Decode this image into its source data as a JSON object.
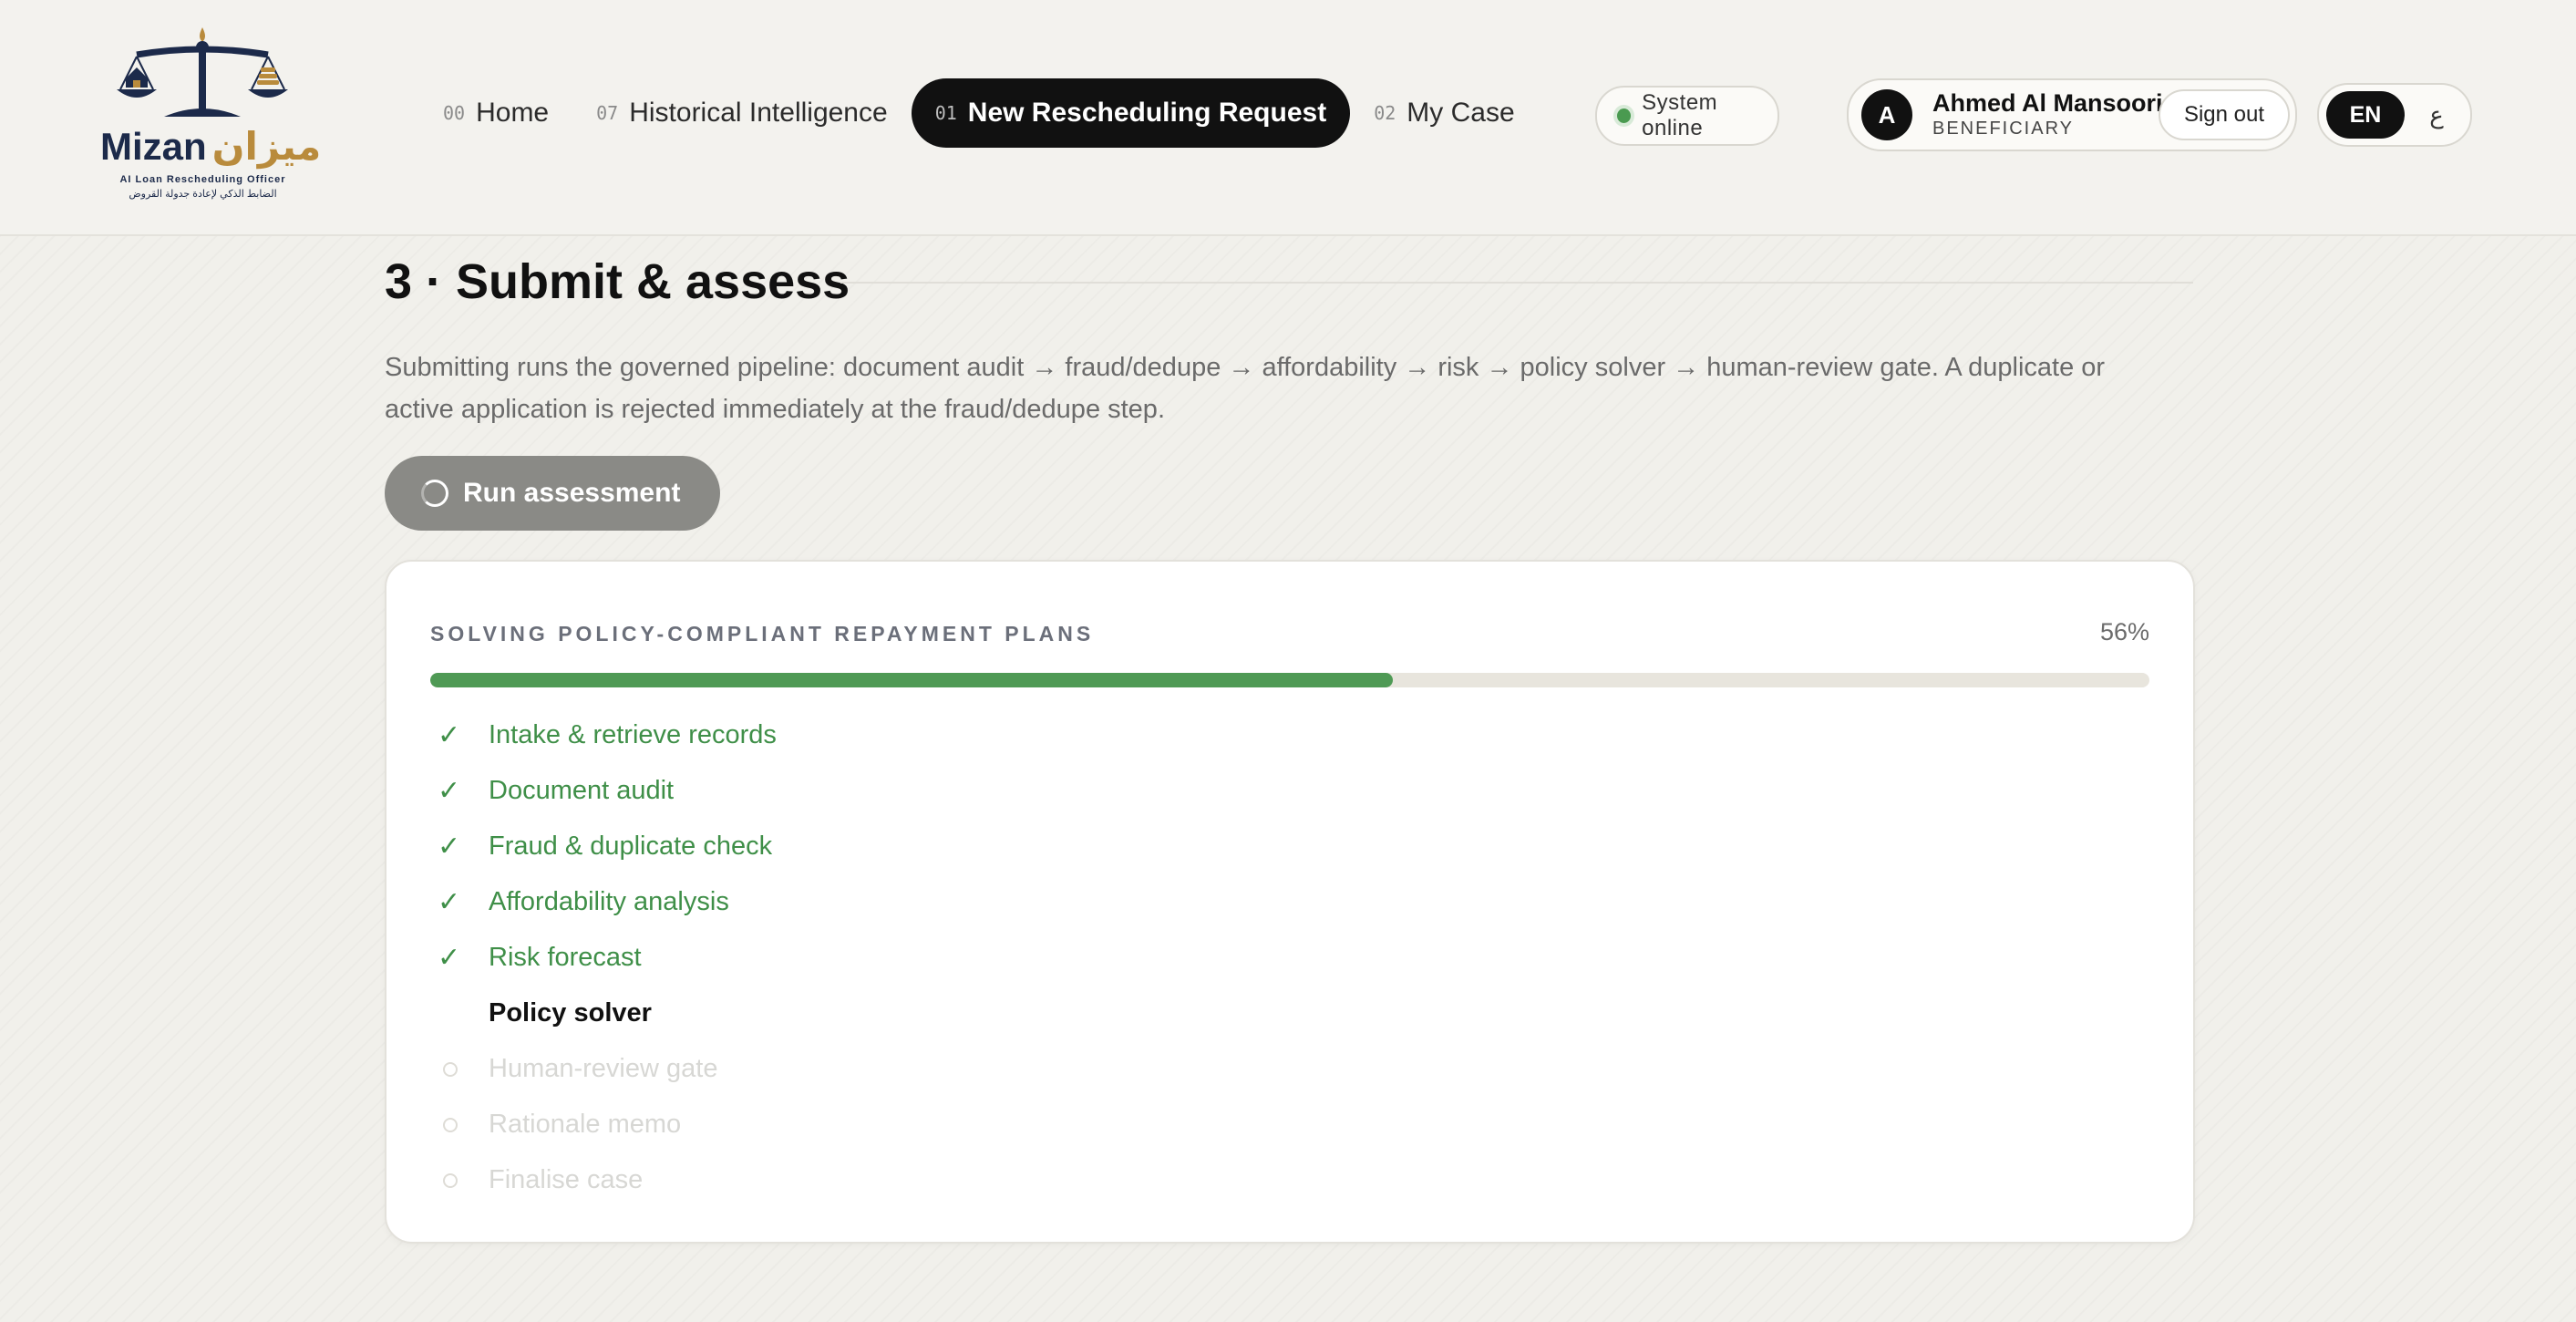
{
  "logo": {
    "name_en": "Mizan",
    "name_ar": "ميزان",
    "subtitle_en": "AI Loan Rescheduling Officer",
    "subtitle_ar": "الضابط الذكي لإعادة جدولة القروض"
  },
  "nav": [
    {
      "num": "00",
      "label": "Home",
      "active": false
    },
    {
      "num": "07",
      "label": "Historical Intelligence",
      "active": false
    },
    {
      "num": "01",
      "label": "New Rescheduling Request",
      "active": true
    },
    {
      "num": "02",
      "label": "My Case",
      "active": false
    }
  ],
  "status": {
    "text": "System online",
    "color": "#4a9a50"
  },
  "user": {
    "initial": "A",
    "name": "Ahmed Al Mansoori",
    "role": "BENEFICIARY",
    "signout_label": "Sign out"
  },
  "language": {
    "en": "EN",
    "ar": "ع",
    "selected": "EN"
  },
  "section": {
    "title": "3 · Submit & assess",
    "description": "Submitting runs the governed pipeline: document audit → fraud/dedupe → affordability → risk → policy solver → human-review gate. A duplicate or active application is rejected immediately at the fraud/dedupe step.",
    "run_button_label": "Run assessment"
  },
  "progress": {
    "stage_label": "SOLVING POLICY-COMPLIANT REPAYMENT PLANS",
    "percent_text": "56%",
    "fraction": 0.56,
    "color": "#4f9a55"
  },
  "steps": [
    {
      "label": "Intake & retrieve records",
      "state": "done"
    },
    {
      "label": "Document audit",
      "state": "done"
    },
    {
      "label": "Fraud & duplicate check",
      "state": "done"
    },
    {
      "label": "Affordability analysis",
      "state": "done"
    },
    {
      "label": "Risk forecast",
      "state": "done"
    },
    {
      "label": "Policy solver",
      "state": "current"
    },
    {
      "label": "Human-review gate",
      "state": "pending"
    },
    {
      "label": "Rationale memo",
      "state": "pending"
    },
    {
      "label": "Finalise case",
      "state": "pending"
    }
  ]
}
